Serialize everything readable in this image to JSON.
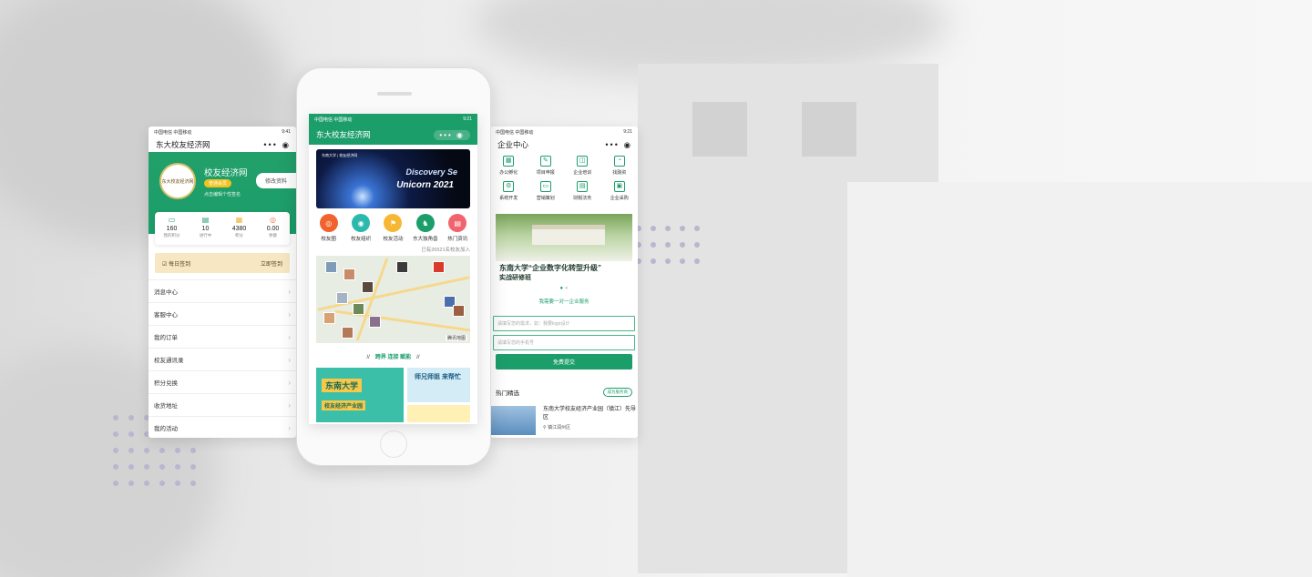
{
  "left": {
    "status_left": "中国电信 中国移动",
    "status_right": "9:41",
    "title": "东大校友经济网",
    "nav_dots": "•••",
    "logo_text": "东大校友经济网",
    "profile_name": "校友经济网",
    "badge": "普通会员",
    "signature": "点击编辑个性签名",
    "edit_button": "修改资料",
    "stats": [
      {
        "value": "160",
        "label": "我的积分"
      },
      {
        "value": "10",
        "label": "进行中"
      },
      {
        "value": "4380",
        "label": "积分"
      },
      {
        "value": "0.00",
        "label": "余额"
      }
    ],
    "daily_label": "每日签到",
    "daily_action": "立即签到",
    "menu": [
      "消息中心",
      "客服中心",
      "我的订单",
      "校友通讯录",
      "积分兑换",
      "收货地址",
      "我的活动"
    ]
  },
  "center": {
    "status_left": "中国电信 中国移动",
    "status_right": "9:21",
    "title": "东大校友经济网",
    "capsule": "•••",
    "banner_title1": "Discovery Se",
    "banner_title2": "Unicorn 2021",
    "banner_header": "东南大学 | 校友经济网",
    "icons": [
      {
        "label": "校友圈",
        "color": "#f0632d",
        "glyph": "◎"
      },
      {
        "label": "校友组织",
        "color": "#2bb9ae",
        "glyph": "◉"
      },
      {
        "label": "校友活动",
        "color": "#f7b733",
        "glyph": "⚑"
      },
      {
        "label": "东大独角兽",
        "color": "#1c9e6b",
        "glyph": "♞"
      },
      {
        "label": "热门资讯",
        "color": "#f1646d",
        "glyph": "▤"
      }
    ],
    "joined": "已有26521名校友加入",
    "map_label": "腾讯地图",
    "slogan": "跨界 连接 赋能",
    "promo1_title": "东南大学",
    "promo1_sub": "校友经济产业园",
    "promo2_title": "师兄师姐 来帮忙"
  },
  "right": {
    "status_left": "中国电信 中国移动",
    "status_right": "9:21",
    "title": "企业中心",
    "nav_dots": "•••",
    "services": [
      {
        "label": "办公孵化",
        "glyph": "▦"
      },
      {
        "label": "项目申报",
        "glyph": "✎"
      },
      {
        "label": "企业培训",
        "glyph": "◫"
      },
      {
        "label": "找融资",
        "glyph": "◔"
      },
      {
        "label": "系统开发",
        "glyph": "⚙"
      },
      {
        "label": "营销策划",
        "glyph": "▭"
      },
      {
        "label": "财税法务",
        "glyph": "▤"
      },
      {
        "label": "企业采购",
        "glyph": "▣"
      }
    ],
    "photo_title": "东南大学“企业数字化转型升级”",
    "photo_sub": "实战研修班",
    "need_service": "我需要一对一企业服务",
    "input1_placeholder": "请填写您的需求，如：我要logo设计",
    "input2_placeholder": "请填写您的手机号",
    "submit": "免费提交",
    "hot_title": "热门精选",
    "hot_join": "成为服务商",
    "card_title": "东南大学校友经济产业园（镇江）先导区",
    "card_loc": "镇江润州区"
  }
}
